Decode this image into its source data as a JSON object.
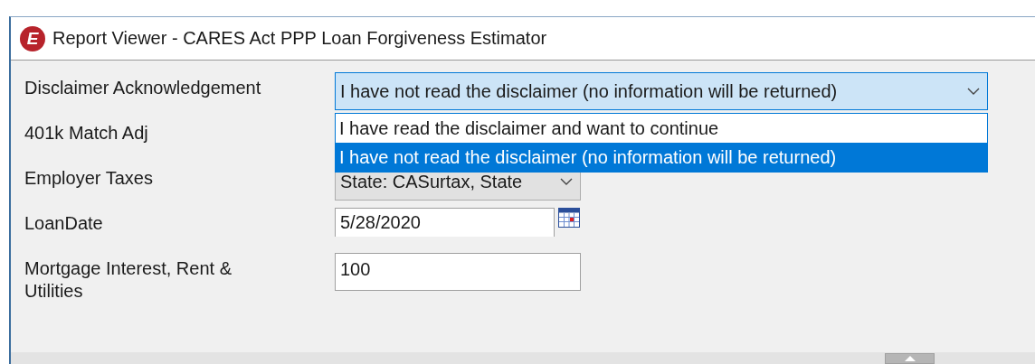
{
  "window": {
    "logo_text": "E",
    "title": "Report Viewer - CARES Act PPP Loan Forgiveness Estimator"
  },
  "parameters": [
    {
      "label": "Disclaimer Acknowledgement",
      "field": {
        "kind": "dropdown",
        "value": "I have not read the disclaimer (no information will be returned)",
        "expanded": true,
        "options": [
          {
            "label": "I have read the disclaimer and want to continue",
            "selected": false
          },
          {
            "label": "I have not read the disclaimer (no information will be returned)",
            "selected": true
          }
        ]
      }
    },
    {
      "label": "401k Match Adj"
    },
    {
      "label": "Employer Taxes",
      "field": {
        "kind": "dropdown",
        "value": "State: CASurtax, State",
        "expanded": false
      }
    },
    {
      "label": "LoanDate",
      "field": {
        "kind": "date",
        "value": "5/28/2020"
      }
    },
    {
      "label": "Mortgage Interest, Rent & Utilities",
      "field": {
        "kind": "text",
        "value": "100"
      }
    }
  ]
}
